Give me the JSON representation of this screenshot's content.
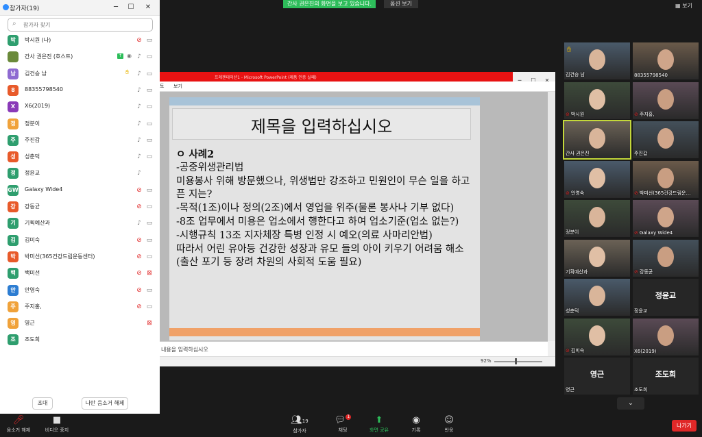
{
  "banner": {
    "text": "간사 권은진의 화면을 보고 있습니다."
  },
  "view_options": {
    "label": "옵션 보기"
  },
  "layout": {
    "label": "보기"
  },
  "participants_panel": {
    "title": "참가자(19)",
    "search_placeholder": "참가자 찾기",
    "participants": [
      {
        "initial": "박",
        "name": "박시원 (나)",
        "color": "#2e9e6e",
        "mic": "off",
        "cam": "on",
        "hand": false,
        "share": false
      },
      {
        "initial": "",
        "name": "간사 권은진 (호스트)",
        "color": "#6a8a3a",
        "mic": "on",
        "cam": "on",
        "hand": false,
        "share": true
      },
      {
        "initial": "남",
        "name": "김건승 남",
        "color": "#8e6ad1",
        "mic": "on",
        "cam": "on",
        "hand": true,
        "share": false
      },
      {
        "initial": "8",
        "name": "88355798540",
        "color": "#e85a2a",
        "mic": "on",
        "cam": "on",
        "hand": false,
        "share": false
      },
      {
        "initial": "X",
        "name": "X6(2019)",
        "color": "#8a3ab8",
        "mic": "on",
        "cam": "on",
        "hand": false,
        "share": false
      },
      {
        "initial": "정",
        "name": "정분이",
        "color": "#f0a23a",
        "mic": "on",
        "cam": "on",
        "hand": false,
        "share": false
      },
      {
        "initial": "주",
        "name": "주진갑",
        "color": "#2e9e6e",
        "mic": "on",
        "cam": "on",
        "hand": false,
        "share": false
      },
      {
        "initial": "성",
        "name": "성춘덕",
        "color": "#e85a2a",
        "mic": "on",
        "cam": "on",
        "hand": false,
        "share": false
      },
      {
        "initial": "정",
        "name": "정윤교",
        "color": "#2e9e6e",
        "mic": "on",
        "cam": "none",
        "hand": false,
        "share": false
      },
      {
        "initial": "GW",
        "name": "Galaxy Wide4",
        "color": "#2e9e6e",
        "mic": "off",
        "cam": "on",
        "hand": false,
        "share": false
      },
      {
        "initial": "강",
        "name": "강동균",
        "color": "#e85a2a",
        "mic": "off",
        "cam": "on",
        "hand": false,
        "share": false
      },
      {
        "initial": "기",
        "name": "기획예산과",
        "color": "#2e9e6e",
        "mic": "on",
        "cam": "on",
        "hand": false,
        "share": false
      },
      {
        "initial": "김",
        "name": "김미숙",
        "color": "#2e9e6e",
        "mic": "off",
        "cam": "on",
        "hand": false,
        "share": false
      },
      {
        "initial": "박",
        "name": "박미선(365건강드림운동센터)",
        "color": "#e85a2a",
        "mic": "off",
        "cam": "on",
        "hand": false,
        "share": false
      },
      {
        "initial": "백",
        "name": "백미선",
        "color": "#2e9e6e",
        "mic": "off",
        "cam": "off",
        "hand": false,
        "share": false
      },
      {
        "initial": "안",
        "name": "안영숙",
        "color": "#2d7dd2",
        "mic": "off",
        "cam": "on",
        "hand": false,
        "share": false
      },
      {
        "initial": "주",
        "name": "주지홍,",
        "color": "#f0a23a",
        "mic": "off",
        "cam": "on",
        "hand": false,
        "share": false
      },
      {
        "initial": "영",
        "name": "영근",
        "color": "#f0a23a",
        "mic": "none",
        "cam": "off",
        "hand": false,
        "share": false
      },
      {
        "initial": "조",
        "name": "조도희",
        "color": "#2e9e6e",
        "mic": "none",
        "cam": "none",
        "hand": false,
        "share": false
      }
    ],
    "invite_label": "초대",
    "unmute_me_label": "나만 음소거 해제"
  },
  "shared_screen": {
    "window_title": "프레젠테이션1 - Microsoft PowerPoint (제품 인증 실패)",
    "ribbon_tabs": [
      "보기"
    ],
    "slide": {
      "title": "제목을 입력하십시오",
      "lines": [
        "ㅇ 사례2",
        "-공중위생관리법",
        "미용봉사 위해 방문했으나, 위생법만 강조하고 민원인이 무슨 일을 하고픈 지는?",
        "-목적(1조)이나 정의(2조)에서 영업을 위주(물론 봉사나 기부 없다)",
        "-8조 업무에서 미용은 업소에서 행한다고 하여 업소기준(업소 없는?)",
        "-시행규칙 13조 지자체장 특병 인정 시 예오(의료 사마리안법)",
        "따라서 어린 유아등 건강한 성장과 유모 들의 아이 키우기 어려움 해소(출산 포기 등 장려 차원의 사회적 도움 필요)"
      ]
    },
    "notes_placeholder": "슬라이드 노트를 입력하십시오",
    "notes_text": "내용을 입력하십시오",
    "zoom": "92%"
  },
  "gallery": [
    {
      "name": "김건승 남",
      "muted": false,
      "video": true,
      "hand": true
    },
    {
      "name": "88355798540",
      "muted": false,
      "video": true,
      "hand": false
    },
    {
      "name": "박시원",
      "muted": true,
      "video": true,
      "hand": false
    },
    {
      "name": "주지홍,",
      "muted": true,
      "video": true,
      "hand": false
    },
    {
      "name": "간사 권은진",
      "muted": false,
      "video": true,
      "hand": false,
      "active": true
    },
    {
      "name": "주진갑",
      "muted": false,
      "video": true,
      "hand": false
    },
    {
      "name": "안영숙",
      "muted": true,
      "video": true,
      "hand": false
    },
    {
      "name": "박미선(365건강드림운…",
      "muted": true,
      "video": true,
      "hand": false
    },
    {
      "name": "정분이",
      "muted": false,
      "video": true,
      "hand": false
    },
    {
      "name": "Galaxy Wide4",
      "muted": true,
      "video": true,
      "hand": false
    },
    {
      "name": "기획예산과",
      "muted": false,
      "video": true,
      "hand": false
    },
    {
      "name": "강동균",
      "muted": true,
      "video": true,
      "hand": false
    },
    {
      "name": "성춘덕",
      "muted": false,
      "video": true,
      "hand": false
    },
    {
      "name": "정윤교",
      "muted": false,
      "video": false,
      "hand": false,
      "big_name": "정윤교"
    },
    {
      "name": "김미숙",
      "muted": true,
      "video": true,
      "hand": false
    },
    {
      "name": "X6(2019)",
      "muted": false,
      "video": true,
      "hand": false
    },
    {
      "name": "영근",
      "muted": false,
      "video": false,
      "hand": false,
      "big_name": "영근"
    },
    {
      "name": "조도희",
      "muted": false,
      "video": false,
      "hand": false,
      "big_name": "조도희"
    }
  ],
  "toolbar": {
    "mute_label": "음소거 해제",
    "video_label": "비디오 중지",
    "participants_label": "참가자",
    "participants_count": "19",
    "chat_label": "채팅",
    "chat_badge": "1",
    "share_label": "화면 공유",
    "record_label": "기록",
    "reactions_label": "반응",
    "leave_label": "나가기"
  }
}
